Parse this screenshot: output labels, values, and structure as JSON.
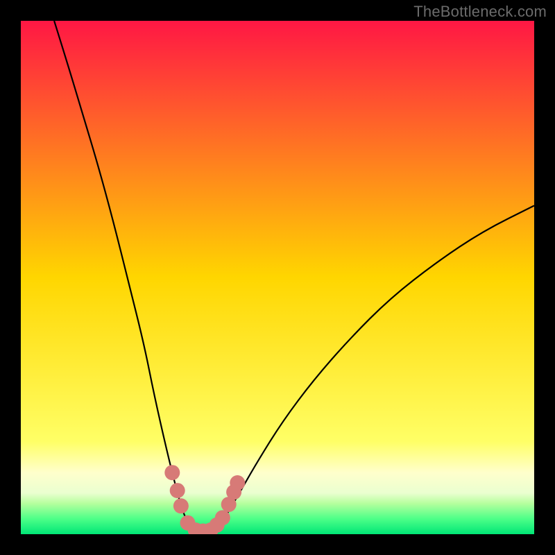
{
  "watermark": "TheBottleneck.com",
  "chart_data": {
    "type": "line",
    "title": "",
    "xlabel": "",
    "ylabel": "",
    "xlim": [
      0,
      100
    ],
    "ylim": [
      0,
      100
    ],
    "background_gradient": {
      "stops": [
        {
          "offset": 0.0,
          "color": "#ff1744"
        },
        {
          "offset": 0.5,
          "color": "#ffd600"
        },
        {
          "offset": 0.82,
          "color": "#ffff66"
        },
        {
          "offset": 0.88,
          "color": "#ffffcc"
        },
        {
          "offset": 0.92,
          "color": "#eaffd0"
        },
        {
          "offset": 0.94,
          "color": "#b6ff9e"
        },
        {
          "offset": 0.97,
          "color": "#4dff88"
        },
        {
          "offset": 1.0,
          "color": "#00e676"
        }
      ]
    },
    "series": [
      {
        "name": "bottleneck-curve",
        "color": "#000000",
        "data": [
          {
            "x": 6.5,
            "y": 100
          },
          {
            "x": 9,
            "y": 92
          },
          {
            "x": 12,
            "y": 82
          },
          {
            "x": 15,
            "y": 72
          },
          {
            "x": 18,
            "y": 61
          },
          {
            "x": 21,
            "y": 49
          },
          {
            "x": 24,
            "y": 37
          },
          {
            "x": 26,
            "y": 27
          },
          {
            "x": 28.5,
            "y": 16
          },
          {
            "x": 30.5,
            "y": 8
          },
          {
            "x": 32,
            "y": 3
          },
          {
            "x": 34,
            "y": 0.5
          },
          {
            "x": 37,
            "y": 0.5
          },
          {
            "x": 39,
            "y": 2
          },
          {
            "x": 42,
            "y": 7
          },
          {
            "x": 46,
            "y": 14
          },
          {
            "x": 51,
            "y": 22
          },
          {
            "x": 57,
            "y": 30
          },
          {
            "x": 64,
            "y": 38
          },
          {
            "x": 72,
            "y": 46
          },
          {
            "x": 81,
            "y": 53
          },
          {
            "x": 90,
            "y": 59
          },
          {
            "x": 100,
            "y": 64
          }
        ]
      }
    ],
    "markers": {
      "name": "salmon-band",
      "color": "#d77a77",
      "data": [
        {
          "x": 29.5,
          "y": 12
        },
        {
          "x": 30.5,
          "y": 8.5
        },
        {
          "x": 31.2,
          "y": 5.5
        },
        {
          "x": 32.5,
          "y": 2.2
        },
        {
          "x": 34.0,
          "y": 0.8
        },
        {
          "x": 35.5,
          "y": 0.6
        },
        {
          "x": 37.0,
          "y": 0.8
        },
        {
          "x": 38.2,
          "y": 1.8
        },
        {
          "x": 39.3,
          "y": 3.2
        },
        {
          "x": 40.5,
          "y": 5.8
        },
        {
          "x": 41.5,
          "y": 8.2
        },
        {
          "x": 42.2,
          "y": 10
        }
      ]
    }
  }
}
